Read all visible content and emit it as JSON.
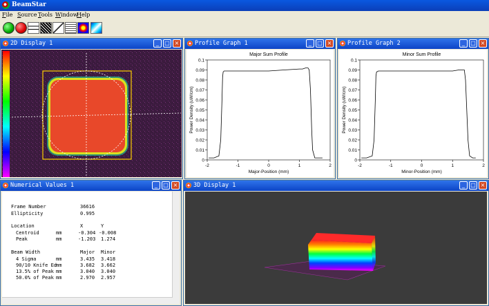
{
  "app": {
    "title": "BeamStar"
  },
  "menu": [
    "File",
    "Source",
    "Tools",
    "Window",
    "Help"
  ],
  "toolbar": {
    "icons": [
      "start-green-icon",
      "stop-red-icon",
      "grid-icon",
      "pattern-icon",
      "measure-icon",
      "list-icon",
      "color-square-icon",
      "beam-3d-icon"
    ]
  },
  "colors": {
    "titlebar": "#0b3fb8",
    "window_title": "#0c44c6",
    "beam_top": "#e8482a",
    "plot_bg": "#ffffff",
    "dark_bg": "#3a3a3a"
  },
  "windows": {
    "display2d": {
      "title": "2D Display 1"
    },
    "profile1": {
      "title": "Profile Graph 1"
    },
    "profile2": {
      "title": "Profile Graph 2"
    },
    "numerical": {
      "title": "Numerical Values 1"
    },
    "display3d": {
      "title": "3D Display 1"
    }
  },
  "numerical": {
    "frame_number": {
      "label": "Frame Number",
      "value": "36616"
    },
    "ellipticity": {
      "label": "Ellipticity",
      "value": "0.995"
    },
    "location": {
      "label": "Location",
      "col1": "X",
      "col2": "Y"
    },
    "centroid": {
      "label": "Centroid",
      "unit": "mm",
      "x": "-0.304",
      "y": "-0.008"
    },
    "peak": {
      "label": "Peak",
      "unit": "mm",
      "x": "-1.203",
      "y": "1.274"
    },
    "beam_width": {
      "label": "Beam Width",
      "col1": "Major",
      "col2": "Minor"
    },
    "sigma4": {
      "label": "4 Sigma",
      "unit": "mm",
      "major": "3.435",
      "minor": "3.418"
    },
    "knife": {
      "label": "90/10 Knife Ed",
      "unit": "mm",
      "major": "3.682",
      "minor": "3.662"
    },
    "pct135": {
      "label": "13.5% of Peak",
      "unit": "mm",
      "major": "3.040",
      "minor": "3.040"
    },
    "pct50": {
      "label": "50.0% of Peak",
      "unit": "mm",
      "major": "2.970",
      "minor": "2.957"
    }
  },
  "chart_data": [
    {
      "type": "line",
      "title": "Major Sum Profile",
      "xlabel": "Major-Position (mm)",
      "ylabel": "Power Density (uW/cm)",
      "xlim": [
        -2,
        2
      ],
      "ylim": [
        0,
        0.1
      ],
      "xticks": [
        "-2",
        "-1",
        "0",
        "1",
        "2"
      ],
      "yticks": [
        "0",
        "0.01",
        "0.02",
        "0.03",
        "0.04",
        "0.05",
        "0.06",
        "0.07",
        "0.08",
        "0.09",
        "0.1"
      ],
      "series": [
        {
          "x": [
            -1.95,
            -1.78,
            -1.62,
            -1.56,
            -1.52,
            -1.5,
            -1.48,
            -1.45,
            -1.3,
            -1.0,
            -0.5,
            0,
            0.5,
            1.0,
            1.1,
            1.2,
            1.28,
            1.32,
            1.36,
            1.4,
            1.43,
            1.5,
            1.6,
            1.75
          ],
          "y": [
            0.002,
            0.002,
            0.004,
            0.02,
            0.06,
            0.083,
            0.088,
            0.089,
            0.089,
            0.089,
            0.089,
            0.089,
            0.09,
            0.091,
            0.091,
            0.092,
            0.092,
            0.09,
            0.07,
            0.03,
            0.01,
            0.002,
            0.002,
            0.002
          ]
        }
      ]
    },
    {
      "type": "line",
      "title": "Minor Sum Profile",
      "xlabel": "Minor-Position (mm)",
      "ylabel": "Power Density (uW/cm)",
      "xlim": [
        -2,
        2
      ],
      "ylim": [
        0,
        0.1
      ],
      "xticks": [
        "-2",
        "-1",
        "0",
        "1",
        "2"
      ],
      "yticks": [
        "0",
        "0.01",
        "0.02",
        "0.03",
        "0.04",
        "0.05",
        "0.06",
        "0.07",
        "0.08",
        "0.09",
        "0.1"
      ],
      "series": [
        {
          "x": [
            -1.95,
            -1.78,
            -1.6,
            -1.54,
            -1.5,
            -1.48,
            -1.46,
            -1.4,
            -1.0,
            -0.5,
            0,
            0.5,
            1.0,
            1.2,
            1.3,
            1.38,
            1.42,
            1.46,
            1.5,
            1.55,
            1.65,
            1.75
          ],
          "y": [
            0.002,
            0.002,
            0.004,
            0.02,
            0.06,
            0.084,
            0.088,
            0.089,
            0.089,
            0.089,
            0.089,
            0.089,
            0.089,
            0.09,
            0.09,
            0.09,
            0.08,
            0.05,
            0.02,
            0.004,
            0.002,
            0.002
          ]
        }
      ]
    }
  ]
}
